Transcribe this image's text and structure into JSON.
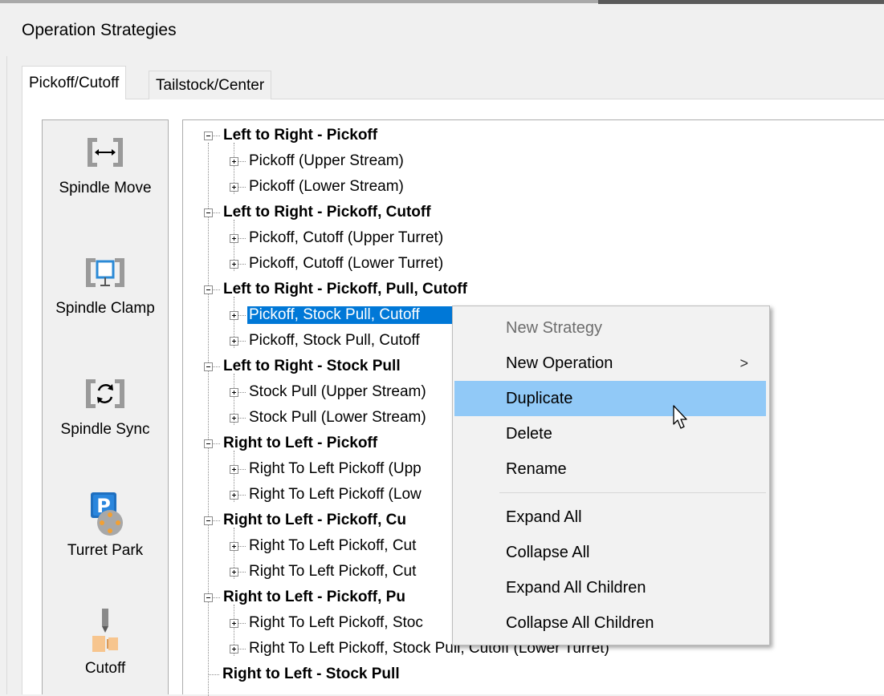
{
  "window": {
    "title": "Operation Strategies"
  },
  "tabs": [
    {
      "label": "Pickoff/Cutoff",
      "active": true
    },
    {
      "label": "Tailstock/Center",
      "active": false
    }
  ],
  "palette": [
    {
      "label": "Spindle Move",
      "icon": "spindle-move-icon"
    },
    {
      "label": "Spindle Clamp",
      "icon": "spindle-clamp-icon"
    },
    {
      "label": "Spindle Sync",
      "icon": "spindle-sync-icon"
    },
    {
      "label": "Turret Park",
      "icon": "turret-park-icon"
    },
    {
      "label": "Cutoff",
      "icon": "cutoff-icon"
    }
  ],
  "tree": {
    "groups": [
      {
        "label": "Left to Right - Pickoff",
        "children": [
          "Pickoff (Upper Stream)",
          "Pickoff (Lower Stream)"
        ]
      },
      {
        "label": "Left to Right - Pickoff, Cutoff",
        "children": [
          "Pickoff, Cutoff (Upper Turret)",
          "Pickoff, Cutoff (Lower Turret)"
        ]
      },
      {
        "label": "Left to Right - Pickoff, Pull, Cutoff",
        "children": [
          "Pickoff, Stock Pull, Cutoff",
          "Pickoff, Stock Pull, Cutoff"
        ]
      },
      {
        "label": "Left to Right - Stock Pull",
        "children": [
          "Stock Pull (Upper Stream)",
          "Stock Pull (Lower Stream)"
        ]
      },
      {
        "label": "Right to Left - Pickoff",
        "children": [
          "Right To Left Pickoff (Upp",
          "Right To Left Pickoff (Low"
        ]
      },
      {
        "label": "Right to Left - Pickoff, Cu",
        "children": [
          "Right To Left Pickoff, Cut",
          "Right To Left Pickoff, Cut"
        ]
      },
      {
        "label": "Right to Left - Pickoff, Pu",
        "children": [
          "Right To Left Pickoff, Stoc",
          "Right To Left Pickoff, Stock Pull, Cutoff (Lower Turret)"
        ]
      },
      {
        "label": "Right to Left - Stock Pull",
        "children": []
      }
    ],
    "selected": "Pickoff, Stock Pull, Cutoff"
  },
  "context_menu": {
    "items": [
      {
        "label": "New Strategy",
        "state": "disabled"
      },
      {
        "label": "New Operation",
        "submenu_arrow": ">"
      },
      {
        "label": "Duplicate",
        "state": "hover"
      },
      {
        "label": "Delete"
      },
      {
        "label": "Rename"
      },
      {
        "label": "Expand All"
      },
      {
        "label": "Collapse All"
      },
      {
        "label": "Expand All Children"
      },
      {
        "label": "Collapse All Children"
      }
    ]
  },
  "colors": {
    "selection": "#0078d7",
    "menu_hover": "#91c9f7",
    "park_icon_blue": "#1f6fbf",
    "cutoff_icon_orange": "#f7c58e"
  }
}
